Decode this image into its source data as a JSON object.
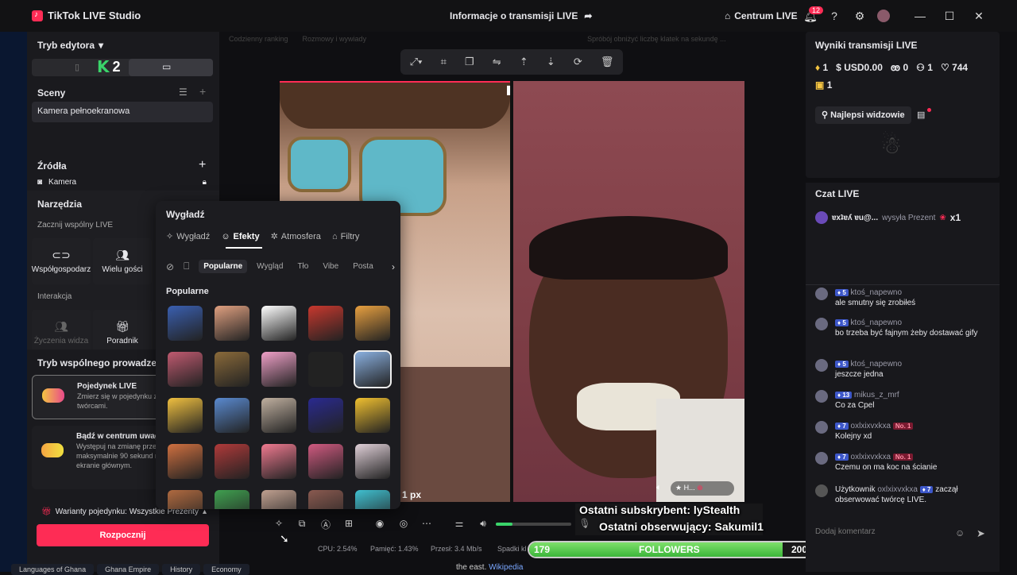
{
  "window": {
    "app_title": "TikTok LIVE Studio",
    "stream_info": "Informacje o transmisji LIVE",
    "centrum": "Centrum LIVE",
    "notifications": "12"
  },
  "left": {
    "editor_mode": "Tryb edytora",
    "overlay_number": "2",
    "scenes_title": "Sceny",
    "scene_item": "Kamera pełnoekranowa",
    "sources_title": "Źródła",
    "source_item": "Kamera",
    "tools_title": "Narzędzia",
    "shared_live": "Zacznij wspólny LIVE",
    "tool_cohost": "Współgospodarz",
    "tool_guests": "Wielu gości",
    "interaction": "Interakcja",
    "tool_wishes": "Życzenia widza",
    "tool_guide": "Poradnik",
    "shared_mode": "Tryb wspólnego prowadzenia",
    "card1_title": "Pojedynek LIVE",
    "card1_desc": "Zmierz się w pojedynku z twórcami.",
    "card2_title": "Bądź w centrum uwagi",
    "card2_desc": "Występuj na zmianę przez maksymalnie 90 sekund na ekranie głównym.",
    "variants": "Warianty pojedynku: Wszystkie Prezenty",
    "start_button": "Rozpocznij"
  },
  "popup": {
    "title": "Wygładź",
    "tabs": [
      "Wygładź",
      "Efekty",
      "Atmosfera",
      "Filtry"
    ],
    "chips": [
      "Popularne",
      "Wygląd",
      "Tło",
      "Vibe",
      "Posta"
    ],
    "section": "Popularne"
  },
  "top_tags": [
    "Codzienny ranking",
    "Rozmowy i wywiady",
    "Spróbój obniżyć liczbę klatek na sekundę ..."
  ],
  "preview": {
    "px_label": "1 px",
    "mini_label": "H..."
  },
  "overlay": {
    "last_sub": "Ostatni subskrybent: lyStealth",
    "last_follow": "Ostatni obserwujący: Sakumil1",
    "follow_start": "179",
    "follow_label": "FOLLOWERS",
    "follow_goal": "200",
    "follow_progress": 0.895
  },
  "stats": {
    "cpu": "CPU: 2.54%",
    "mem": "Pamięć: 1.43%",
    "bitrate": "Przesł: 3.4 Mb/s",
    "drops": "Spadki kl"
  },
  "right": {
    "results_title": "Wyniki transmisji LIVE",
    "diamonds": "1",
    "usd": "USD0.00",
    "viewers": "0",
    "followers": "1",
    "likes": "744",
    "shares": "1",
    "top_viewers": "Najlepsi widzowie",
    "chat_title": "Czat LIVE",
    "gift_user": "ɐxʇɐʎ ɐu@...",
    "gift_text": "wysyła Prezent",
    "gift_count": "x1",
    "comment_placeholder": "Dodaj komentarz"
  },
  "chat": [
    {
      "level": "5",
      "user": "ktoś_napewno",
      "text": "ale smutny się zrobiłeś",
      "badge": ""
    },
    {
      "level": "5",
      "user": "ktoś_napewno",
      "text": "bo trzeba być fajnym żeby dostawać gify",
      "badge": ""
    },
    {
      "level": "5",
      "user": "ktoś_napewno",
      "text": "jeszcze jedna",
      "badge": ""
    },
    {
      "level": "13",
      "user": "mikus_z_mrf",
      "text": "Co za Cpel",
      "badge": ""
    },
    {
      "level": "7",
      "user": "oxlxixvxkxa",
      "text": "Kolejny xd",
      "badge": "No. 1"
    },
    {
      "level": "7",
      "user": "oxlxixvxkxa",
      "text": "Czemu on ma koc na ścianie",
      "badge": "No. 1"
    }
  ],
  "follow_event": {
    "prefix": "Użytkownik",
    "user": "oxlxixvxkxa",
    "level": "7",
    "suffix": "zaczął",
    "line2": "obserwować twórcę LIVE."
  },
  "taskbar": [
    "Languages of Ghana",
    "Ghana Empire",
    "History",
    "Economy"
  ],
  "wiki_text": "the east.",
  "wiki_link": "Wikipedia"
}
